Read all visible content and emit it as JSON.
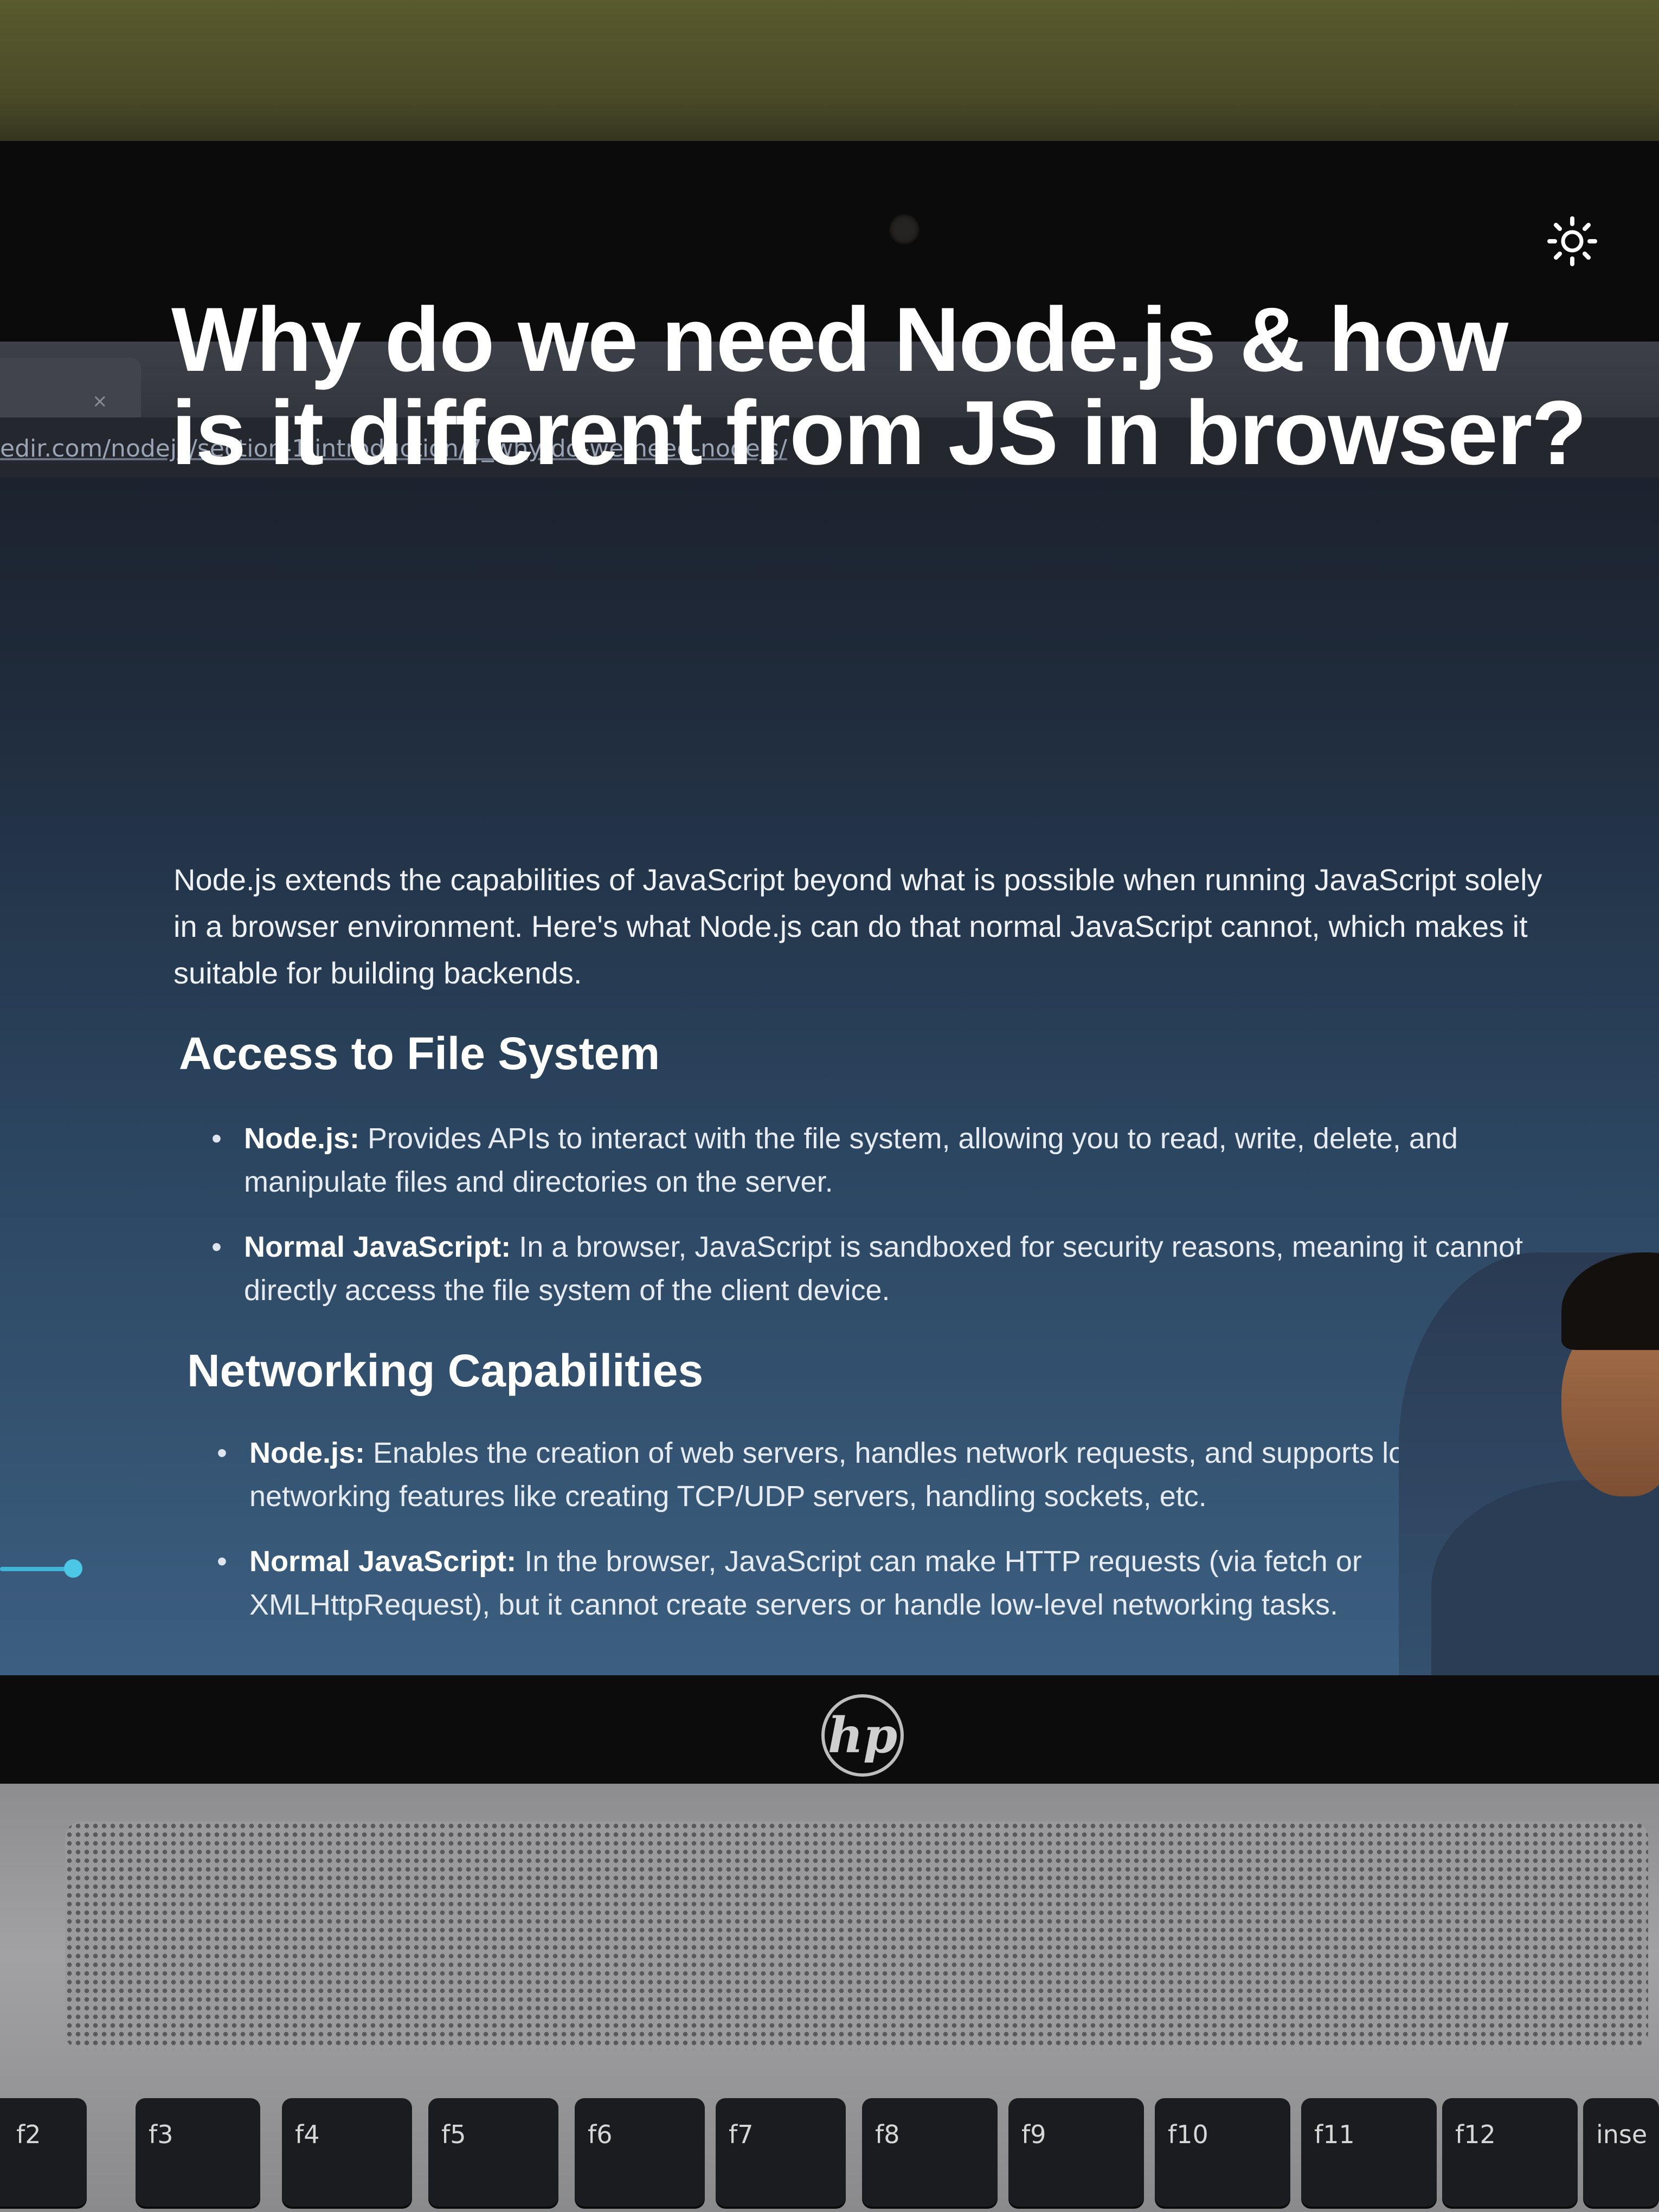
{
  "browser": {
    "tab_close_glyph": "×",
    "url": "edir.com/nodejs/section-1 introduction/7_why-do-we-need-nodejs/"
  },
  "page": {
    "title_line1": "Why do we need Node.js & how",
    "title_line2": "is it different from JS in browser?",
    "intro": "Node.js extends the capabilities of JavaScript beyond what is possible when running JavaScript solely in a browser environment. Here's what Node.js can do that normal JavaScript cannot, which makes it suitable for building backends.",
    "sections": [
      {
        "heading": "Access to File System",
        "items": [
          {
            "label": "Node.js:",
            "text": " Provides APIs to interact with the file system, allowing you to read, write, delete, and manipulate files and directories on the server."
          },
          {
            "label": "Normal JavaScript:",
            "text": " In a browser, JavaScript is sandboxed for security reasons, meaning it cannot directly access the file system of the client device."
          }
        ]
      },
      {
        "heading": "Networking Capabilities",
        "items": [
          {
            "label": "Node.js:",
            "text": " Enables the creation of web servers, handles network requests, and supports low-level networking features like creating TCP/UDP servers, handling sockets, etc."
          },
          {
            "label": "Normal JavaScript:",
            "text": " In the browser, JavaScript can make HTTP requests (via fetch or XMLHttpRequest), but it cannot create servers or handle low-level networking tasks."
          }
        ]
      }
    ],
    "theme_icon": "sun-icon"
  },
  "laptop": {
    "brand": "hp",
    "keys": [
      "f2",
      "f3",
      "f4",
      "f5",
      "f6",
      "f7",
      "f8",
      "f9",
      "f10",
      "f11",
      "f12",
      "inse"
    ]
  },
  "colors": {
    "accent": "#4cc7e6",
    "screen_top": "#1a1e27",
    "screen_bottom": "#3c5f80"
  }
}
